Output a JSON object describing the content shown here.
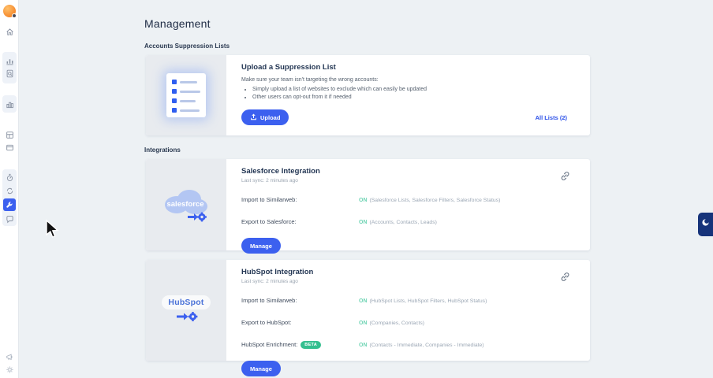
{
  "page": {
    "title": "Management"
  },
  "sidebar": {
    "icons": [
      "home",
      "traffic-chart",
      "report-search",
      "analytics-bars",
      "grid-apps",
      "list-card",
      "stopwatch",
      "sync",
      "management-tools",
      "chat-bubble",
      "megaphone",
      "settings-gear"
    ]
  },
  "suppression": {
    "section_label": "Accounts Suppression Lists",
    "title": "Upload a Suppression List",
    "description": "Make sure your team isn't targeting the wrong accounts:",
    "bullets": [
      "Simply upload a list of websites to exclude which can easily be updated",
      "Other users can opt-out from it if needed"
    ],
    "upload_label": "Upload",
    "all_lists_label": "All Lists (2)"
  },
  "integrations": {
    "section_label": "Integrations",
    "cards": [
      {
        "title": "Salesforce Integration",
        "last_sync": "Last sync: 2 minutes ago",
        "logo_text": "salesforce",
        "manage_label": "Manage",
        "rows": [
          {
            "label": "Import to Similarweb:",
            "status": "ON",
            "detail": "(Salesforce Lists, Salesforce Filters, Salesforce Status)"
          },
          {
            "label": "Export to Salesforce:",
            "status": "ON",
            "detail": "(Accounts, Contacts, Leads)"
          }
        ]
      },
      {
        "title": "HubSpot Integration",
        "last_sync": "Last sync: 2 minutes ago",
        "logo_text": "HubSpot",
        "manage_label": "Manage",
        "rows": [
          {
            "label": "Import to Similarweb:",
            "status": "ON",
            "detail": "(HubSpot Lists, HubSpot Filters, HubSpot Status)"
          },
          {
            "label": "Export to HubSpot:",
            "status": "ON",
            "detail": "(Companies, Contacts)"
          },
          {
            "label": "HubSpot Enrichment:",
            "badge": "BETA",
            "status": "ON",
            "detail": "(Contacts - Immediate, Companies - Immediate)"
          }
        ]
      }
    ]
  },
  "colors": {
    "primary_blue": "#3c60ef",
    "link_blue": "#2b50e8",
    "status_on_green": "#6fd4b4",
    "beta_badge_green": "#35bf8f",
    "background": "#edf1f4",
    "widget_navy": "#16337a"
  }
}
